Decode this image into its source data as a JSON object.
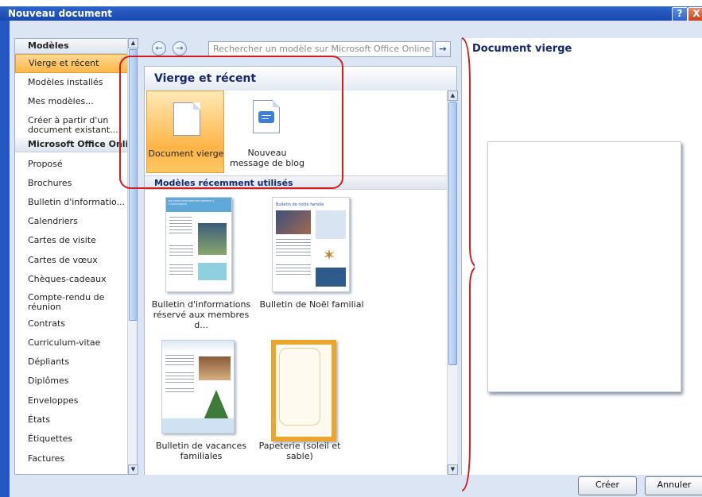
{
  "window": {
    "title": "Nouveau document",
    "help_label": "?",
    "close_label": "X"
  },
  "nav": {
    "heading_modeles": "Modèles",
    "heading_online": "Microsoft Office Online",
    "items_local": [
      {
        "label": "Vierge et récent",
        "selected": true
      },
      {
        "label": "Modèles installés"
      },
      {
        "label": "Mes modèles..."
      },
      {
        "label": "Créer à partir d'un document existant..."
      }
    ],
    "items_online": [
      "Proposé",
      "Brochures",
      "Bulletin d'informatio...",
      "Calendriers",
      "Cartes de visite",
      "Cartes de vœux",
      "Chèques-cadeaux",
      "Compte-rendu de réunion",
      "Contrats",
      "Curriculum-vitae",
      "Dépliants",
      "Diplômes",
      "Enveloppes",
      "États",
      "Étiquettes",
      "Factures"
    ]
  },
  "search": {
    "placeholder": "Rechercher un modèle sur Microsoft Office Online",
    "go_icon": "arrow-right-icon"
  },
  "middle": {
    "header": "Vierge et récent",
    "blank": {
      "line1": "Document vierge"
    },
    "blog": {
      "line1": "Nouveau",
      "line2": "message de blog"
    },
    "recent_header": "Modèles récemment utilisés",
    "recent": [
      {
        "line1": "Bulletin d'informations",
        "line2": "réservé aux membres d..."
      },
      {
        "line1": "Bulletin de Noël familial",
        "line2": ""
      },
      {
        "line1": "Bulletin de vacances",
        "line2": "familiales"
      },
      {
        "line1": "Papeterie (soleil et",
        "line2": "sable)"
      }
    ],
    "thumb_texts": {
      "newsletter_banner": "BULLETIN D'INFORMATION RÉSERVÉ À L'ASSOCIATION",
      "noel_title": "Bulletin de notre famille"
    }
  },
  "preview": {
    "title": "Document vierge"
  },
  "buttons": {
    "create": "Créer",
    "cancel": "Annuler"
  },
  "colors": {
    "title_bar": "#1f52bf",
    "accent": "#ffb445",
    "annotation": "#d21b1b",
    "heading_text": "#14286b"
  }
}
